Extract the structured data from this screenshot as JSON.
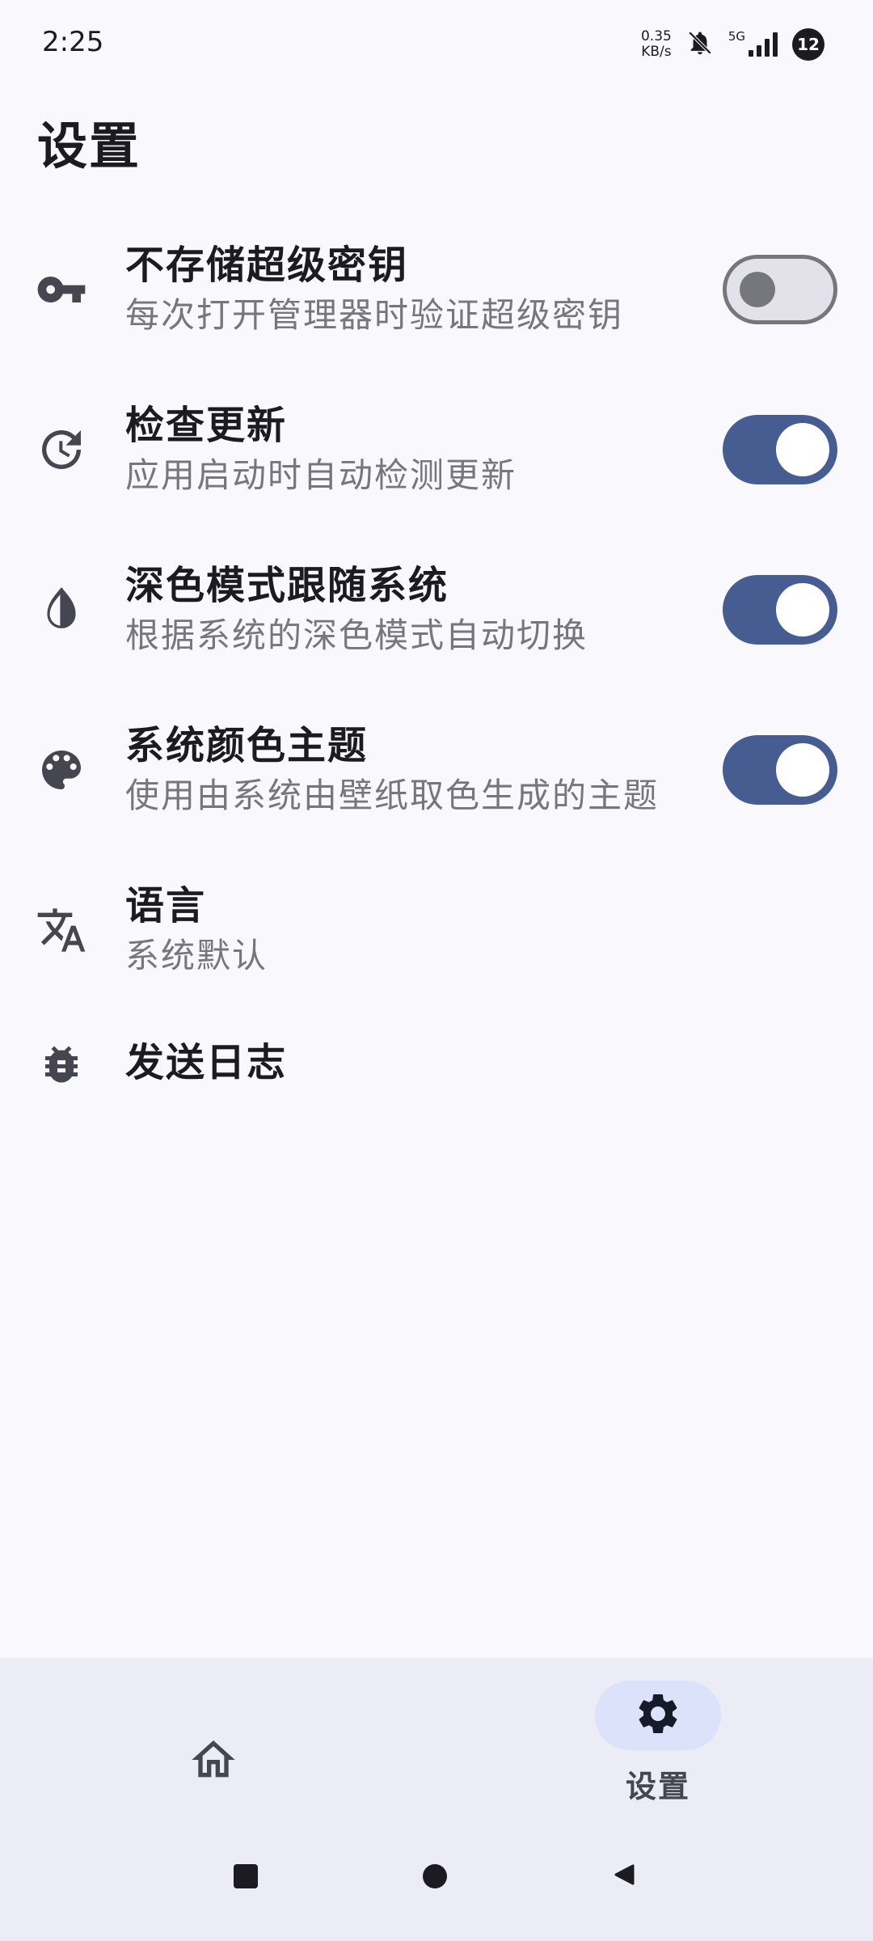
{
  "status_bar": {
    "time": "2:25",
    "net_speed_value": "0.35",
    "net_speed_unit": "KB/s",
    "network_type": "5G",
    "battery": "12"
  },
  "page": {
    "title": "设置"
  },
  "settings": [
    {
      "title": "不存储超级密钥",
      "subtitle": "每次打开管理器时验证超级密钥",
      "icon": "key-icon",
      "toggle": "off"
    },
    {
      "title": "检查更新",
      "subtitle": "应用启动时自动检测更新",
      "icon": "update-icon",
      "toggle": "on"
    },
    {
      "title": "深色模式跟随系统",
      "subtitle": "根据系统的深色模式自动切换",
      "icon": "contrast-icon",
      "toggle": "on"
    },
    {
      "title": "系统颜色主题",
      "subtitle": "使用由系统由壁纸取色生成的主题",
      "icon": "palette-icon",
      "toggle": "on"
    },
    {
      "title": "语言",
      "subtitle": "系统默认",
      "icon": "translate-icon"
    },
    {
      "title": "发送日志",
      "icon": "bug-icon"
    }
  ],
  "bottom_nav": {
    "settings_label": "设置"
  },
  "colors": {
    "background": "#f9f8fd",
    "accent": "#475d92",
    "nav_background": "#ececf6",
    "nav_pill": "#dce2f9",
    "secondary_text": "#77767f"
  }
}
